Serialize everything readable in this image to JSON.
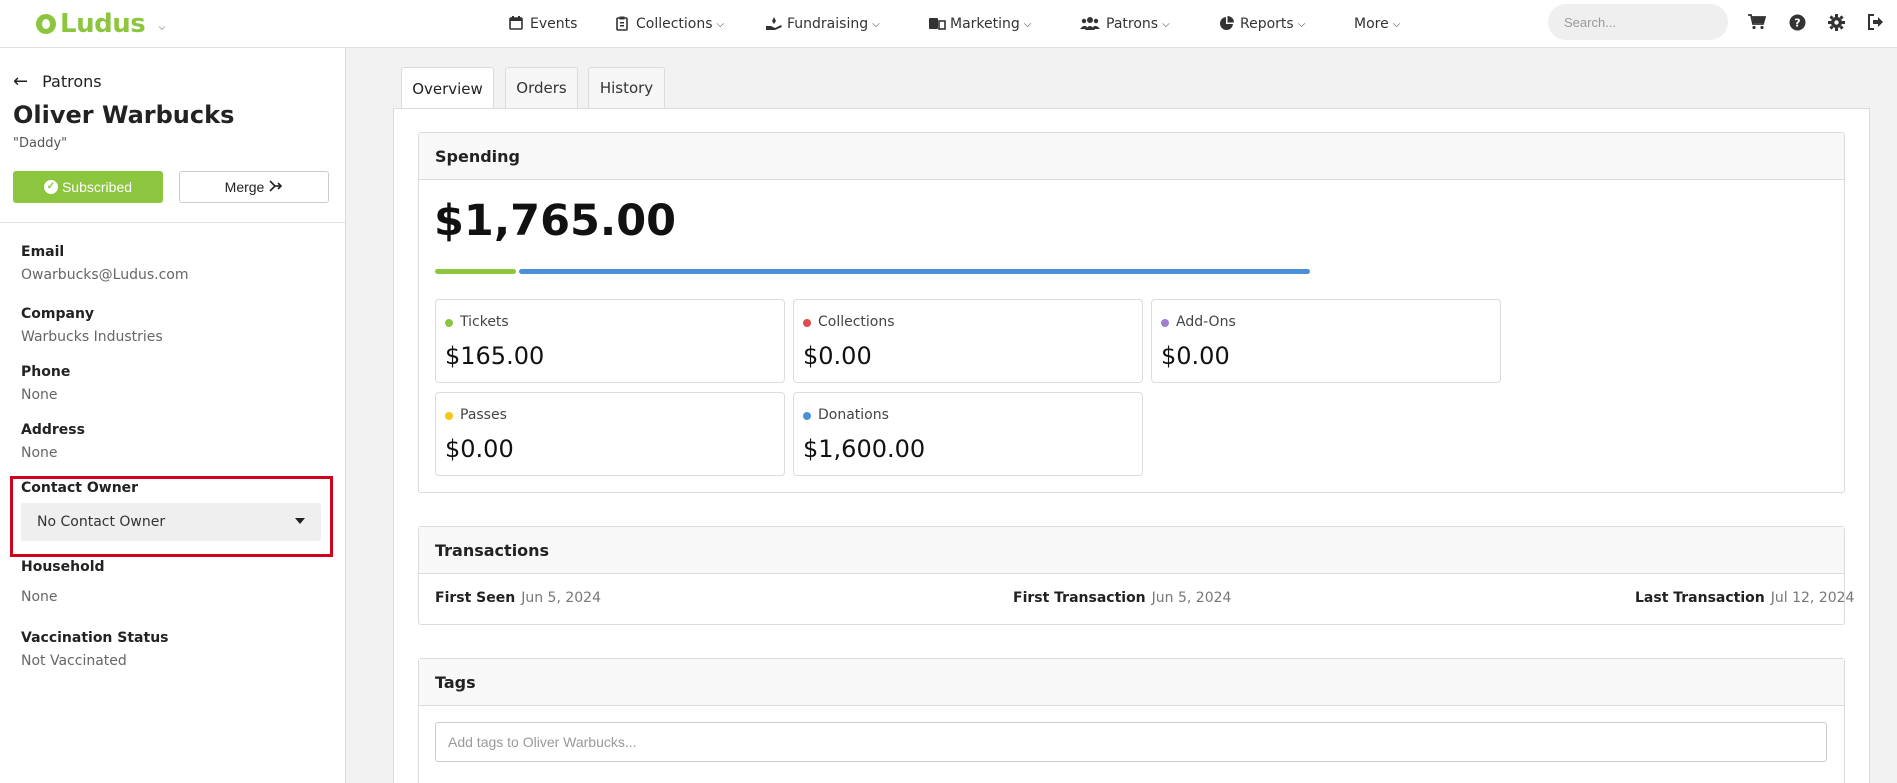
{
  "app": {
    "logo_text": "Ludus"
  },
  "nav": {
    "items": [
      {
        "label": "Events",
        "icon": "calendar-icon",
        "caret": false
      },
      {
        "label": "Collections",
        "icon": "clipboard-icon",
        "caret": true
      },
      {
        "label": "Fundraising",
        "icon": "hand-donate-icon",
        "caret": true
      },
      {
        "label": "Marketing",
        "icon": "megaphone-icon",
        "caret": true
      },
      {
        "label": "Patrons",
        "icon": "users-icon",
        "caret": true
      },
      {
        "label": "Reports",
        "icon": "pie-chart-icon",
        "caret": true
      },
      {
        "label": "More",
        "icon": "",
        "caret": true
      }
    ],
    "search_placeholder": "Search...",
    "right_icons": [
      "cart-icon",
      "help-icon",
      "gear-icon",
      "logout-icon"
    ]
  },
  "sidebar": {
    "back_label": "Patrons",
    "patron_name": "Oliver Warbucks",
    "nickname": "\"Daddy\"",
    "subscribed_label": "Subscribed",
    "merge_label": "Merge",
    "fields": [
      {
        "label": "Email",
        "value": "Owarbucks@Ludus.com"
      },
      {
        "label": "Company",
        "value": "Warbucks Industries"
      },
      {
        "label": "Phone",
        "value": "None"
      },
      {
        "label": "Address",
        "value": "None"
      },
      {
        "label": "Contact Owner",
        "value": "No Contact Owner"
      },
      {
        "label": "Household",
        "value": "None"
      },
      {
        "label": "Vaccination Status",
        "value": "Not Vaccinated"
      }
    ]
  },
  "tabs": [
    {
      "label": "Overview",
      "active": true
    },
    {
      "label": "Orders",
      "active": false
    },
    {
      "label": "History",
      "active": false
    }
  ],
  "spending": {
    "title": "Spending",
    "total": "$1,765.00",
    "stats": [
      {
        "label": "Tickets",
        "value": "$165.00",
        "color": "#8cc63f"
      },
      {
        "label": "Collections",
        "value": "$0.00",
        "color": "#e04b4b"
      },
      {
        "label": "Add-Ons",
        "value": "$0.00",
        "color": "#a07fd0"
      },
      {
        "label": "Passes",
        "value": "$0.00",
        "color": "#f5c518"
      },
      {
        "label": "Donations",
        "value": "$1,600.00",
        "color": "#4a90d9"
      }
    ]
  },
  "transactions": {
    "title": "Transactions",
    "first_seen_label": "First Seen",
    "first_seen_value": "Jun 5, 2024",
    "first_transaction_label": "First Transaction",
    "first_transaction_value": "Jun 5, 2024",
    "last_transaction_label": "Last Transaction",
    "last_transaction_value": "Jul 12, 2024"
  },
  "tags": {
    "title": "Tags",
    "placeholder": "Add tags to Oliver Warbucks..."
  }
}
